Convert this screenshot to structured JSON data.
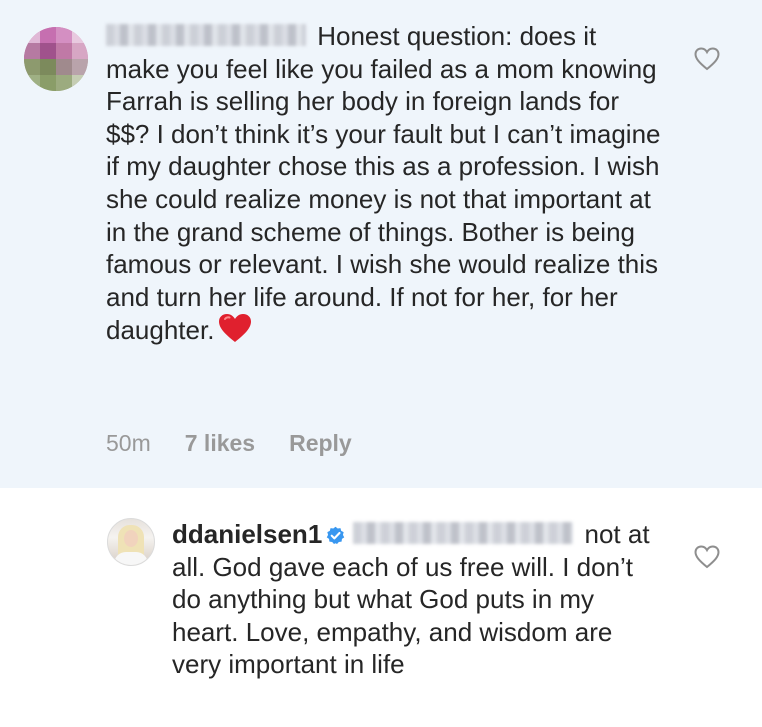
{
  "comments": [
    {
      "author_redacted": true,
      "text": "Honest question: does it make you feel like you failed as a mom knowing Farrah is selling her body in foreign lands for $$? I don’t think it’s your fault but I can’t imagine if my daughter chose this as a profession. I wish she could realize money is not that important at in the grand scheme of things. Bother is being famous or relevant. I wish she would realize this and turn her life around. If not for her, for her daughter.",
      "emoji": "❤️",
      "time": "50m",
      "likes": "7 likes",
      "reply_label": "Reply"
    },
    {
      "username": "ddanielsen1",
      "verified": true,
      "mention_redacted": true,
      "text": "not at all. God gave each of us free will. I don’t do anything but what God puts in my heart. Love, empathy, and wisdom are very important in life"
    }
  ],
  "icons": {
    "like": "heart-outline-icon",
    "verified": "verified-badge-icon"
  },
  "colors": {
    "highlight_bg": "#eff5fb",
    "text": "#262626",
    "meta": "#999999",
    "verified_blue": "#3897f0",
    "heart_red": "#e0202e"
  }
}
